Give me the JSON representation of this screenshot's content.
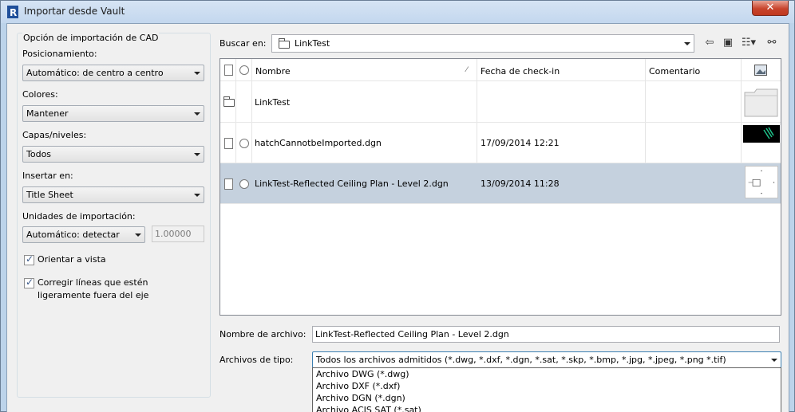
{
  "window": {
    "title": "Importar desde Vault",
    "close_label": "✕"
  },
  "options": {
    "group_title": "Opción de importación de CAD",
    "positioning": {
      "label": "Posicionamiento:",
      "value": "Automático: de centro a centro"
    },
    "colors": {
      "label": "Colores:",
      "value": "Mantener"
    },
    "layers": {
      "label": "Capas/niveles:",
      "value": "Todos"
    },
    "insert_in": {
      "label": "Insertar en:",
      "value": "Title Sheet"
    },
    "units": {
      "label": "Unidades de importación:",
      "value": "Automático: detectar",
      "scale": "1.00000"
    },
    "orient_to_view": {
      "label": "Orientar a vista",
      "checked": true
    },
    "correct_lines": {
      "label_line1": "Corregir líneas que estén",
      "label_line2": "ligeramente fuera del eje",
      "checked": true
    }
  },
  "browser": {
    "look_in_label": "Buscar en:",
    "look_in_value": "LinkTest",
    "columns": {
      "name": "Nombre",
      "checkin_date": "Fecha de check-in",
      "comment": "Comentario"
    },
    "rows": [
      {
        "type": "folder",
        "name": "LinkTest",
        "date": "",
        "comment": ""
      },
      {
        "type": "file",
        "name": "hatchCannotbeImported.dgn",
        "date": "17/09/2014 12:21",
        "comment": ""
      },
      {
        "type": "file",
        "name": "LinkTest-Reflected Ceiling Plan - Level 2.dgn",
        "date": "13/09/2014 11:28",
        "comment": "",
        "selected": true
      }
    ]
  },
  "filename": {
    "label": "Nombre de archivo:",
    "value": "LinkTest-Reflected Ceiling Plan - Level 2.dgn"
  },
  "filetype": {
    "label": "Archivos de tipo:",
    "value": "Todos los archivos admitidos (*.dwg, *.dxf, *.dgn, *.sat, *.skp, *.bmp, *.jpg, *.jpeg, *.png *.tif)",
    "options": [
      "Archivo DWG (*.dwg)",
      "Archivo DXF (*.dxf)",
      "Archivo DGN (*.dgn)",
      "Archivo ACIS SAT (*.sat)"
    ]
  },
  "colors": {
    "selection": "#c5d1de",
    "titlebar": "#c3d7ee",
    "close": "#c8442c",
    "dialog_bg": "#f0f0f0"
  }
}
